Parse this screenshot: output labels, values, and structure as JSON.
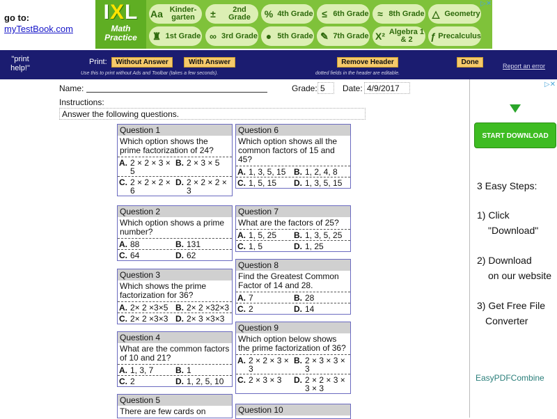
{
  "goto": {
    "label": "go to:",
    "link": "myTestBook.com"
  },
  "ixl": {
    "logo_top": "IXL",
    "logo_bottom_1": "Math",
    "logo_bottom_2": "Practice",
    "buttons_row1": [
      {
        "sym": "Aa",
        "label": "Kinder-garten"
      },
      {
        "sym": "±",
        "label": "2nd Grade"
      },
      {
        "sym": "%",
        "label": "4th Grade"
      },
      {
        "sym": "≤",
        "label": "6th Grade"
      },
      {
        "sym": "≈",
        "label": "8th Grade"
      },
      {
        "sym": "△",
        "label": "Geometry"
      }
    ],
    "buttons_row2": [
      {
        "sym": "♜",
        "label": "1st Grade"
      },
      {
        "sym": "∞",
        "label": "3rd Grade"
      },
      {
        "sym": "●",
        "label": "5th Grade"
      },
      {
        "sym": "✎",
        "label": "7th Grade"
      },
      {
        "sym": "X²",
        "label": "Algebra 1 & 2"
      },
      {
        "sym": "ƒ",
        "label": "Precalculus"
      }
    ]
  },
  "toolbar": {
    "print_help": "\"print help!\"",
    "print_label": "Print:",
    "without_answer": "Without Answer",
    "with_answer": "With Answer",
    "remove_header": "Remove Header",
    "done": "Done",
    "report": "Report an error",
    "note1": "Use this to print without Ads and Toolbar (takes a few seconds).",
    "note2": "dotted fields in the header are editable."
  },
  "sheet": {
    "name_label": "Name:",
    "grade_label": "Grade:",
    "grade_value": "5",
    "date_label": "Date:",
    "date_value": "4/9/2017",
    "instructions_label": "Instructions:",
    "instructions_value": "Answer the following questions."
  },
  "questions_left": [
    {
      "title": "Question 1",
      "text": "Which option shows the prime factorization of 24?",
      "rows": [
        [
          {
            "l": "A.",
            "t": "2 × 2 × 3 × 5"
          },
          {
            "l": "B.",
            "t": "2 × 3 × 5"
          }
        ],
        [
          {
            "l": "C.",
            "t": "2 × 2 × 2 × 6"
          },
          {
            "l": "D.",
            "t": "2 × 2 × 2 × 3"
          }
        ]
      ]
    },
    {
      "title": "Question 2",
      "text": "Which option shows a prime number?",
      "rows": [
        [
          {
            "l": "A.",
            "t": "88"
          },
          {
            "l": "B.",
            "t": "131"
          }
        ],
        [
          {
            "l": "C.",
            "t": "64"
          },
          {
            "l": "D.",
            "t": "62"
          }
        ]
      ]
    },
    {
      "title": "Question 3",
      "text": "Which shows the prime factorization for 36?",
      "rows": [
        [
          {
            "l": "A.",
            "t": "2× 2 ×3×5"
          },
          {
            "l": "B.",
            "t": "2× 2 ×32×3"
          }
        ],
        [
          {
            "l": "C.",
            "t": "2× 2 ×3×3"
          },
          {
            "l": "D.",
            "t": "2× 3 ×3×3"
          }
        ]
      ]
    },
    {
      "title": "Question 4",
      "text": "What are the common factors of 10 and 21?",
      "rows": [
        [
          {
            "l": "A.",
            "t": "1, 3, 7"
          },
          {
            "l": "B.",
            "t": "1"
          }
        ],
        [
          {
            "l": "C.",
            "t": "2"
          },
          {
            "l": "D.",
            "t": "1, 2, 5, 10"
          }
        ]
      ]
    },
    {
      "title": "Question 5",
      "text": "There are few cards on",
      "rows": []
    }
  ],
  "questions_right": [
    {
      "title": "Question 6",
      "text": "Which option shows all the common factors of 15 and 45?",
      "rows": [
        [
          {
            "l": "A.",
            "t": "1, 3, 5, 15"
          },
          {
            "l": "B.",
            "t": "1, 2, 4, 8"
          }
        ],
        [
          {
            "l": "C.",
            "t": "1, 5, 15"
          },
          {
            "l": "D.",
            "t": "1, 3, 5, 15"
          }
        ]
      ]
    },
    {
      "title": "Question 7",
      "text": "What are the factors of 25?",
      "rows": [
        [
          {
            "l": "A.",
            "t": "1, 5, 25"
          },
          {
            "l": "B.",
            "t": "1, 3, 5, 25"
          }
        ],
        [
          {
            "l": "C.",
            "t": "1, 5"
          },
          {
            "l": "D.",
            "t": "1, 25"
          }
        ]
      ]
    },
    {
      "title": "Question 8",
      "text": "Find the Greatest Common Factor of 14 and 28.",
      "rows": [
        [
          {
            "l": "A.",
            "t": "7"
          },
          {
            "l": "B.",
            "t": "28"
          }
        ],
        [
          {
            "l": "C.",
            "t": "2"
          },
          {
            "l": "D.",
            "t": "14"
          }
        ]
      ]
    },
    {
      "title": "Question 9",
      "text": "Which option below shows the prime factorization of 36?",
      "rows": [
        [
          {
            "l": "A.",
            "t": "2 × 2 × 3 × 3"
          },
          {
            "l": "B.",
            "t": "2 × 3 × 3 × 3"
          }
        ],
        [
          {
            "l": "C.",
            "t": "2 × 3 × 3"
          },
          {
            "l": "D.",
            "t": "2 × 2 × 3 × 3 × 3"
          }
        ]
      ]
    },
    {
      "title": "Question 10",
      "text": "",
      "rows": []
    }
  ],
  "ad": {
    "download": "START DOWNLOAD",
    "steps": "3 Easy Steps:",
    "s1a": "1) Click",
    "s1b": "\"Download\"",
    "s2a": "2) Download",
    "s2b": "on our website",
    "s3a": "3) Get Free File",
    "s3b": "Converter",
    "brand": "EasyPDFCombine"
  }
}
